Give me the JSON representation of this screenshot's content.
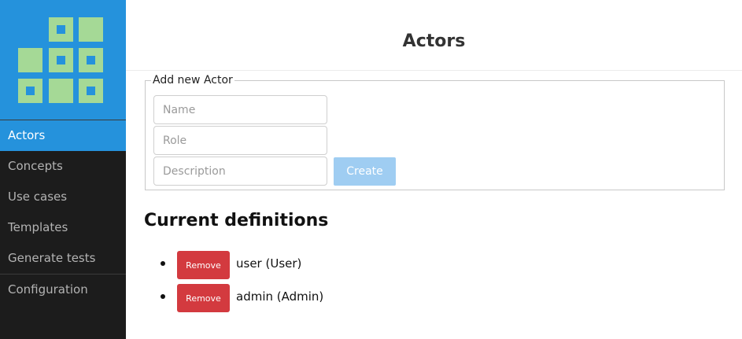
{
  "colors": {
    "brand": "#2592dc",
    "sidebar_bg": "#1c1c1c",
    "logo_light": "#a5d996",
    "create_button": "#9fcdf2",
    "remove_button": "#d33a3f"
  },
  "logo": {
    "icon": "grid-logo-icon"
  },
  "sidebar": {
    "items": [
      {
        "label": "Actors",
        "active": true
      },
      {
        "label": "Concepts",
        "active": false
      },
      {
        "label": "Use cases",
        "active": false
      },
      {
        "label": "Templates",
        "active": false
      },
      {
        "label": "Generate tests",
        "active": false
      },
      {
        "label": "Configuration",
        "active": false
      }
    ]
  },
  "header": {
    "title": "Actors"
  },
  "form": {
    "legend": "Add new Actor",
    "name": {
      "value": "",
      "placeholder": "Name"
    },
    "role": {
      "value": "",
      "placeholder": "Role"
    },
    "description": {
      "value": "",
      "placeholder": "Description"
    },
    "create_label": "Create"
  },
  "definitions": {
    "title": "Current definitions",
    "remove_label": "Remove",
    "items": [
      {
        "text": "user (User)"
      },
      {
        "text": "admin (Admin)"
      }
    ]
  }
}
